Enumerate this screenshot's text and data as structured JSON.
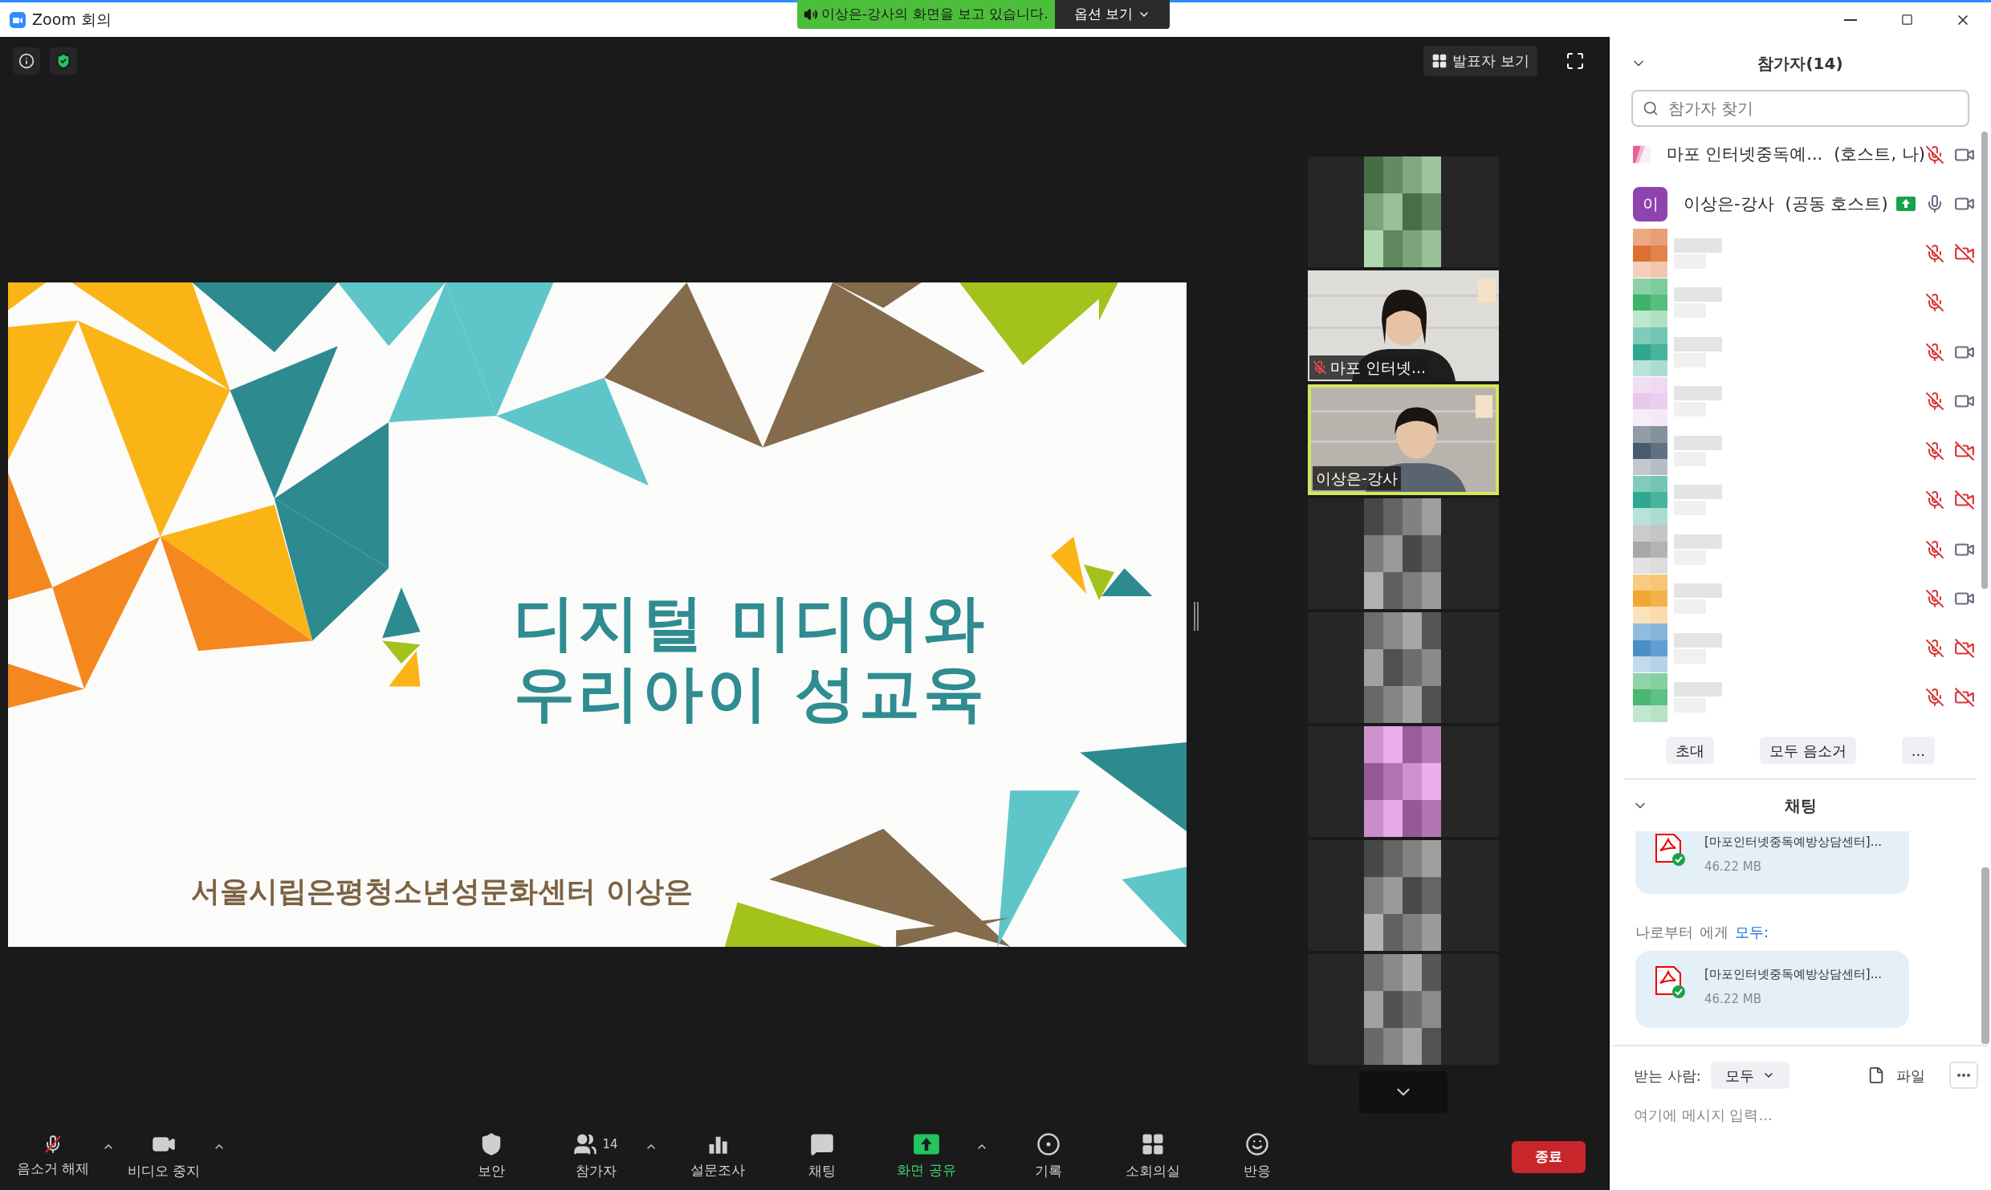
{
  "window": {
    "title": "Zoom 회의"
  },
  "share_banner": {
    "text": "이상은-강사의 화면을 보고 있습니다.",
    "options_button": "옵션 보기"
  },
  "meeting_bar": {
    "view_button": "발표자 보기"
  },
  "slide": {
    "title_lines": [
      "디지털 미디어와",
      "우리아이 성교육"
    ],
    "subtitle": "서울시립은평청소년성문화센터 이상은"
  },
  "video_tiles": [
    {
      "kind": "blurred",
      "active": false
    },
    {
      "kind": "camera",
      "name": "마포 인터넷...",
      "muted": true,
      "active": false
    },
    {
      "kind": "camera",
      "name": "이상은-강사",
      "muted": false,
      "active": true
    },
    {
      "kind": "blurred",
      "active": false
    },
    {
      "kind": "blurred",
      "active": false
    },
    {
      "kind": "blurred",
      "active": false
    },
    {
      "kind": "blurred",
      "active": false
    },
    {
      "kind": "blurred",
      "active": false
    }
  ],
  "toolbar": [
    {
      "kind": "audio",
      "label": "음소거 해제",
      "muted": true,
      "menu": true,
      "highlight": false
    },
    {
      "kind": "video",
      "label": "비디오 중지",
      "off": false,
      "menu": true,
      "highlight": false
    },
    {
      "kind": "security",
      "label": "보안",
      "menu": false,
      "highlight": false
    },
    {
      "kind": "participants",
      "label": "참가자",
      "count": "14",
      "menu": true,
      "highlight": false
    },
    {
      "kind": "poll",
      "label": "설문조사",
      "menu": false,
      "highlight": false
    },
    {
      "kind": "chat",
      "label": "채팅",
      "menu": false,
      "highlight": false
    },
    {
      "kind": "share",
      "label": "화면 공유",
      "menu": true,
      "highlight": true
    },
    {
      "kind": "record",
      "label": "기록",
      "menu": false,
      "highlight": false
    },
    {
      "kind": "breakout",
      "label": "소회의실",
      "menu": false,
      "highlight": false
    },
    {
      "kind": "reactions",
      "label": "반응",
      "menu": false,
      "highlight": false
    }
  ],
  "end_button": "종료",
  "participants": {
    "title": "참가자(14)",
    "search_placeholder": "참가자 찾기",
    "items": [
      {
        "name": "마포 인터넷중독예...",
        "role": "(호스트, 나)",
        "muted": true,
        "video_off": false,
        "sharing": false
      },
      {
        "kind": "initial",
        "initial": "이",
        "color": "#8e44ad",
        "name": "이상은-강사",
        "role": "(공동 호스트)",
        "muted": false,
        "video_off": false,
        "sharing": true
      },
      {
        "kind": "blurred",
        "color": "#dd7030",
        "muted": true,
        "video_off": true,
        "sharing": false
      },
      {
        "kind": "blurred",
        "color": "#3cb46a",
        "muted": true,
        "sharing": false
      },
      {
        "kind": "blurred",
        "color": "#2ea88e",
        "muted": true,
        "video_off": false,
        "sharing": false
      },
      {
        "kind": "blurred",
        "color": "#e8c8ec",
        "muted": true,
        "video_off": false,
        "sharing": false
      },
      {
        "kind": "blurred",
        "color": "#4a5a6e",
        "muted": true,
        "video_off": true,
        "sharing": false
      },
      {
        "kind": "blurred",
        "color": "#2ea890",
        "muted": true,
        "video_off": true,
        "sharing": false
      },
      {
        "kind": "blurred",
        "color": "#a8a8a8",
        "muted": true,
        "video_off": false,
        "sharing": false
      },
      {
        "kind": "blurred",
        "color": "#f2a830",
        "muted": true,
        "video_off": false,
        "sharing": false
      },
      {
        "kind": "blurred",
        "color": "#4a90c8",
        "muted": true,
        "video_off": true,
        "sharing": false
      },
      {
        "kind": "blurred",
        "color": "#48b872",
        "muted": true,
        "video_off": true,
        "sharing": false
      }
    ],
    "buttons": [
      "초대",
      "모두 음소거",
      "..."
    ]
  },
  "chat": {
    "title": "채팅",
    "messages": [
      {
        "file": "[마포인터넷중독예방상담센터]...",
        "size": "46.22 MB"
      },
      {
        "from": "나로부터",
        "to_label": "에게",
        "to": "모두:",
        "file": "[마포인터넷중독예방상담센터]...",
        "size": "46.22 MB"
      }
    ],
    "recipient_label": "받는 사람:",
    "recipient": "모두",
    "file_button": "파일",
    "input_placeholder": "여기에 메시지 입력..."
  }
}
